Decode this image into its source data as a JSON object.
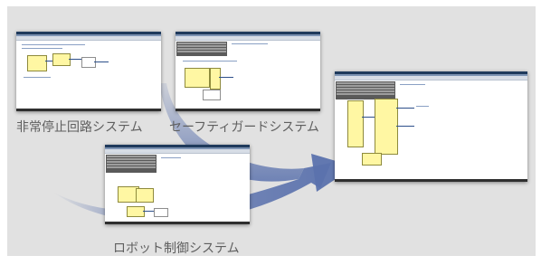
{
  "labels": {
    "estop": "非常停止回路システム",
    "safeguard": "セーフティガードシステム",
    "robot": "ロボット制御システム"
  },
  "colors": {
    "panel_background": "#e1e1e1",
    "arrow_blue": "#5b72ad",
    "label_gray": "#5f5f5f",
    "function_block_yellow": "#fff7a3"
  },
  "thumbnails": [
    {
      "name": "estop-program-screen"
    },
    {
      "name": "safeguard-program-screen"
    },
    {
      "name": "robot-program-screen"
    },
    {
      "name": "combined-program-screen"
    }
  ]
}
